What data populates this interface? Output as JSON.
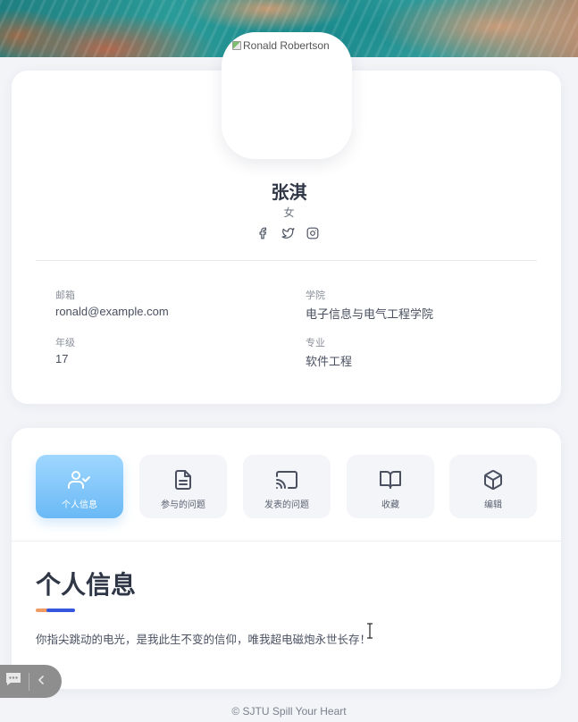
{
  "profile": {
    "avatar_alt": "Ronald Robertson",
    "name": "张淇",
    "gender": "女",
    "social_icons": [
      "facebook-icon",
      "twitter-icon",
      "instagram-icon"
    ],
    "fields": {
      "email_label": "邮箱",
      "email_value": "ronald@example.com",
      "college_label": "学院",
      "college_value": "电子信息与电气工程学院",
      "grade_label": "年级",
      "grade_value": "17",
      "major_label": "专业",
      "major_value": "软件工程"
    }
  },
  "tabs": [
    {
      "label": "个人信息",
      "icon": "user-check-icon",
      "active": true
    },
    {
      "label": "参与的问题",
      "icon": "file-text-icon",
      "active": false
    },
    {
      "label": "发表的问题",
      "icon": "cast-icon",
      "active": false
    },
    {
      "label": "收藏",
      "icon": "book-open-icon",
      "active": false
    },
    {
      "label": "编辑",
      "icon": "box-icon",
      "active": false
    }
  ],
  "section": {
    "title": "个人信息",
    "motto": "你指尖跳动的电光，是我此生不变的信仰，唯我超电磁炮永世长存！"
  },
  "footer": "© SJTU Spill Your Heart",
  "colors": {
    "accent_blue": "#3557e0",
    "accent_orange": "#f19a62",
    "active_tab": "#6ab9f5"
  }
}
